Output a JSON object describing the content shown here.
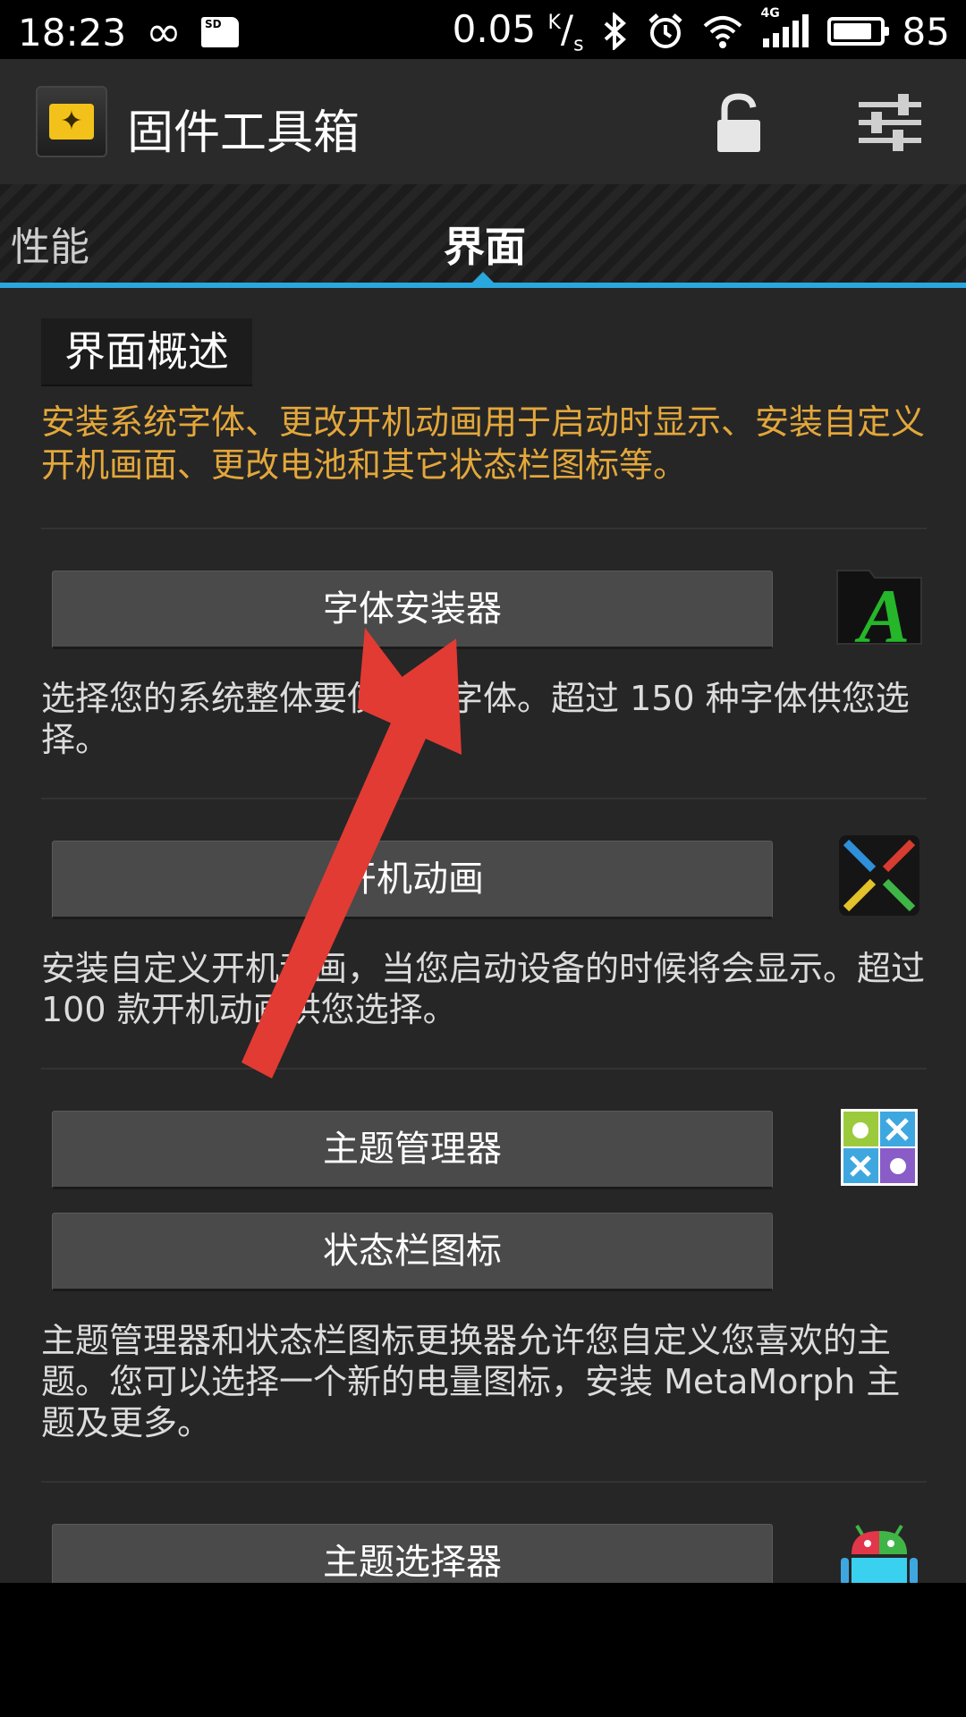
{
  "status_bar": {
    "time": "18:23",
    "network_speed": "0.05",
    "speed_unit_top": "K",
    "speed_unit_bottom": "s",
    "network_type": "4G",
    "battery_level": "85",
    "battery_fraction": 0.85
  },
  "app_bar": {
    "title": "固件工具箱"
  },
  "tabs": [
    {
      "label": "性能"
    },
    {
      "label": "界面"
    }
  ],
  "overview": {
    "heading": "界面概述",
    "text": "安装系统字体、更改开机动画用于启动时显示、安装自定义开机画面、更改电池和其它状态栏图标等。"
  },
  "sections": [
    {
      "button": "字体安装器",
      "desc": "选择您的系统整体要使用的字体。超过 150 种字体供您选择。",
      "icon": "font-icon"
    },
    {
      "button": "开机动画",
      "desc": "安装自定义开机动画，当您启动设备的时候将会显示。超过 100 款开机动画供您选择。",
      "icon": "boot-animation-icon"
    },
    {
      "button": "主题管理器",
      "button2": "状态栏图标",
      "desc": "主题管理器和状态栏图标更换器允许您自定义您喜欢的主题。您可以选择一个新的电量图标，安装 MetaMorph 主题及更多。",
      "icon": "theme-manager-icon"
    },
    {
      "button": "主题选择器",
      "icon": "android-theme-icon"
    }
  ],
  "colors": {
    "accent": "#2aa7dc",
    "overview_text": "#e3a73b",
    "arrow": "#e23b33"
  }
}
